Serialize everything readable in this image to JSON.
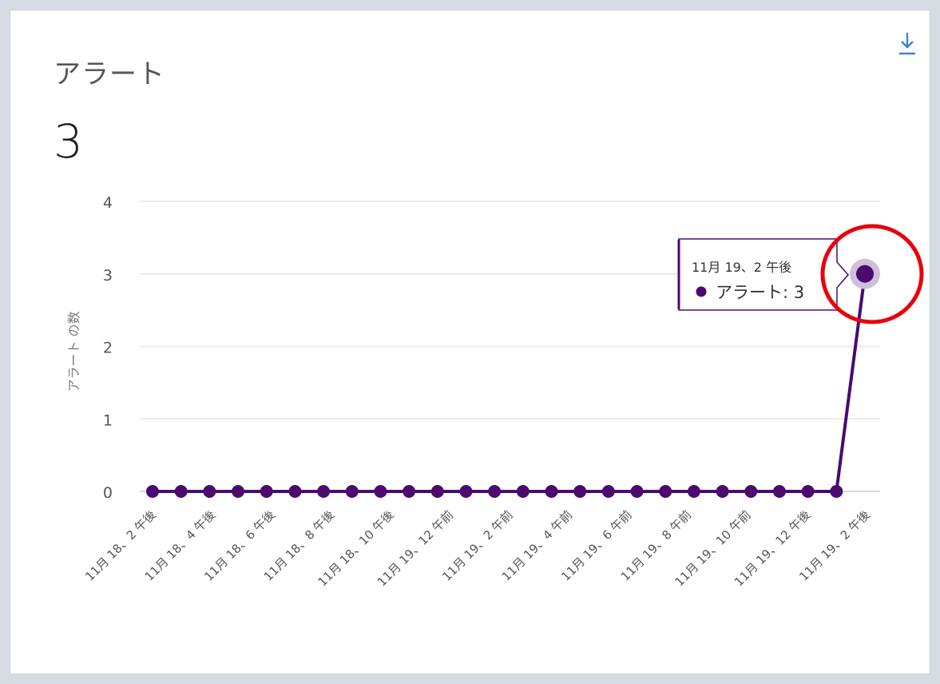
{
  "card": {
    "title": "アラート",
    "value": "3",
    "download_icon": "download-icon"
  },
  "colors": {
    "series": "#4b0a6e",
    "grid": "#e3e6ea",
    "axis_text": "#555555",
    "annotation": "#e8000b"
  },
  "tooltip": {
    "title": "11月 19、2 午後",
    "series_label": "アラート",
    "value": "3"
  },
  "chart_data": {
    "type": "line",
    "ylabel": "アラート の数",
    "ylim": [
      0,
      4
    ],
    "yticks": [
      "0",
      "1",
      "2",
      "3",
      "4"
    ],
    "xtick_labels": [
      "11月 18、2 午後",
      "11月 18、4 午後",
      "11月 18、6 午後",
      "11月 18、8 午後",
      "11月 18、10 午後",
      "11月 19、12 午前",
      "11月 19、2 午前",
      "11月 19、4 午前",
      "11月 19、6 午前",
      "11月 19、8 午前",
      "11月 19、10 午前",
      "11月 19、12 午後",
      "11月 19、2 午後"
    ],
    "series": [
      {
        "name": "アラート",
        "values": [
          0,
          0,
          0,
          0,
          0,
          0,
          0,
          0,
          0,
          0,
          0,
          0,
          0,
          0,
          0,
          0,
          0,
          0,
          0,
          0,
          0,
          0,
          0,
          0,
          0,
          3
        ]
      }
    ],
    "grid": true,
    "highlighted_point": {
      "series": 0,
      "index": 25
    }
  }
}
